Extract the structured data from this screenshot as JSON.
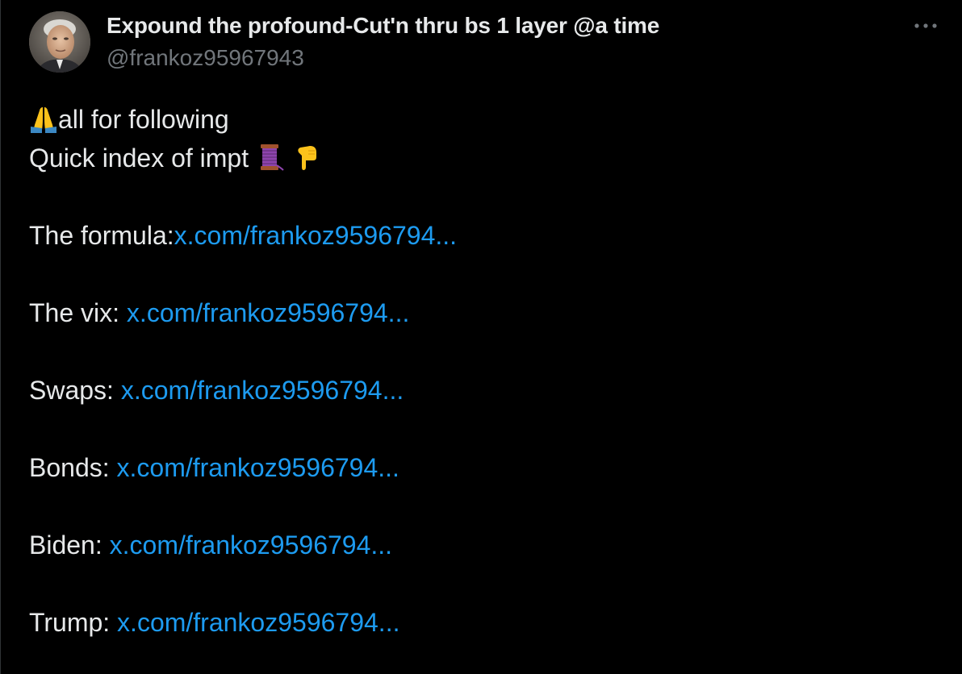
{
  "author": {
    "display_name": "Expound the profound-Cut'n thru bs 1 layer @a time",
    "handle": "@frankoz95967943",
    "avatar_icon": "profile-photo"
  },
  "more_icon": "more-horizontal-icon",
  "tweet": {
    "line1_emoji": "folded-hands-icon",
    "line1_text": "all for following",
    "line2_text": "Quick index of impt",
    "line2_emojis": [
      "thread-spool-icon",
      "pointing-down-icon"
    ],
    "links": [
      {
        "label": "The formula:",
        "url_text": "x.com/frankoz9596794..."
      },
      {
        "label": "The vix: ",
        "url_text": "x.com/frankoz9596794..."
      },
      {
        "label": "Swaps: ",
        "url_text": "x.com/frankoz9596794..."
      },
      {
        "label": "Bonds: ",
        "url_text": "x.com/frankoz9596794..."
      },
      {
        "label": "Biden: ",
        "url_text": "x.com/frankoz9596794..."
      },
      {
        "label": "Trump: ",
        "url_text": "x.com/frankoz9596794..."
      }
    ]
  },
  "colors": {
    "background": "#000000",
    "text": "#e7e9ea",
    "secondary": "#71767b",
    "link": "#1d9bf0"
  }
}
